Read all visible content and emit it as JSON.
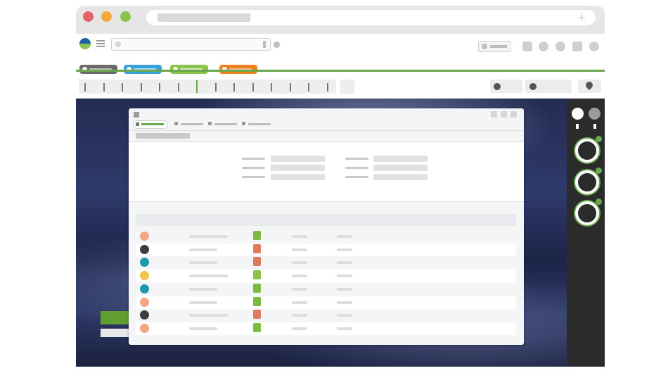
{
  "browser": {
    "address_placeholder": "",
    "new_tab_icon": "plus-icon"
  },
  "toolbar": {
    "logo": "app-logo",
    "menu_icon": "hamburger-icon",
    "search_placeholder": ""
  },
  "colored_tabs": [
    {
      "color": "#6b6b6b",
      "bar": "#bcbcbc"
    },
    {
      "color": "#3aa0d8",
      "bar": "#a9d7f0"
    },
    {
      "color": "#8bc34a",
      "bar": "#d6ec b4"
    },
    {
      "color": "#f07f1e",
      "bar": "#f9c48f"
    }
  ],
  "accent_color": "#6aa84f",
  "timeline": {
    "selected_index": 6,
    "tick_count": 14
  },
  "sidebar": {
    "top_icons": [
      "status-online-icon",
      "status-offline-icon"
    ],
    "items": [
      "user-ring-1",
      "user-ring-2",
      "user-ring-3"
    ]
  },
  "modal": {
    "tabs": [
      "tab-1",
      "tab-2",
      "tab-3",
      "tab-4"
    ],
    "active_tab": 0,
    "rows": [
      {
        "avatar": "#f4a582",
        "product": "#7dbb3c"
      },
      {
        "avatar": "#3c3c3c",
        "product": "#e07a5f"
      },
      {
        "avatar": "#1b9aaa",
        "product": "#e07a5f"
      },
      {
        "avatar": "#f2c14e",
        "product": "#8bc34a"
      },
      {
        "avatar": "#1b9aaa",
        "product": "#7dbb3c"
      },
      {
        "avatar": "#f4a582",
        "product": "#7dbb3c"
      },
      {
        "avatar": "#3c3c3c",
        "product": "#e07a5f"
      },
      {
        "avatar": "#f4a582",
        "product": "#7dbb3c"
      }
    ]
  }
}
